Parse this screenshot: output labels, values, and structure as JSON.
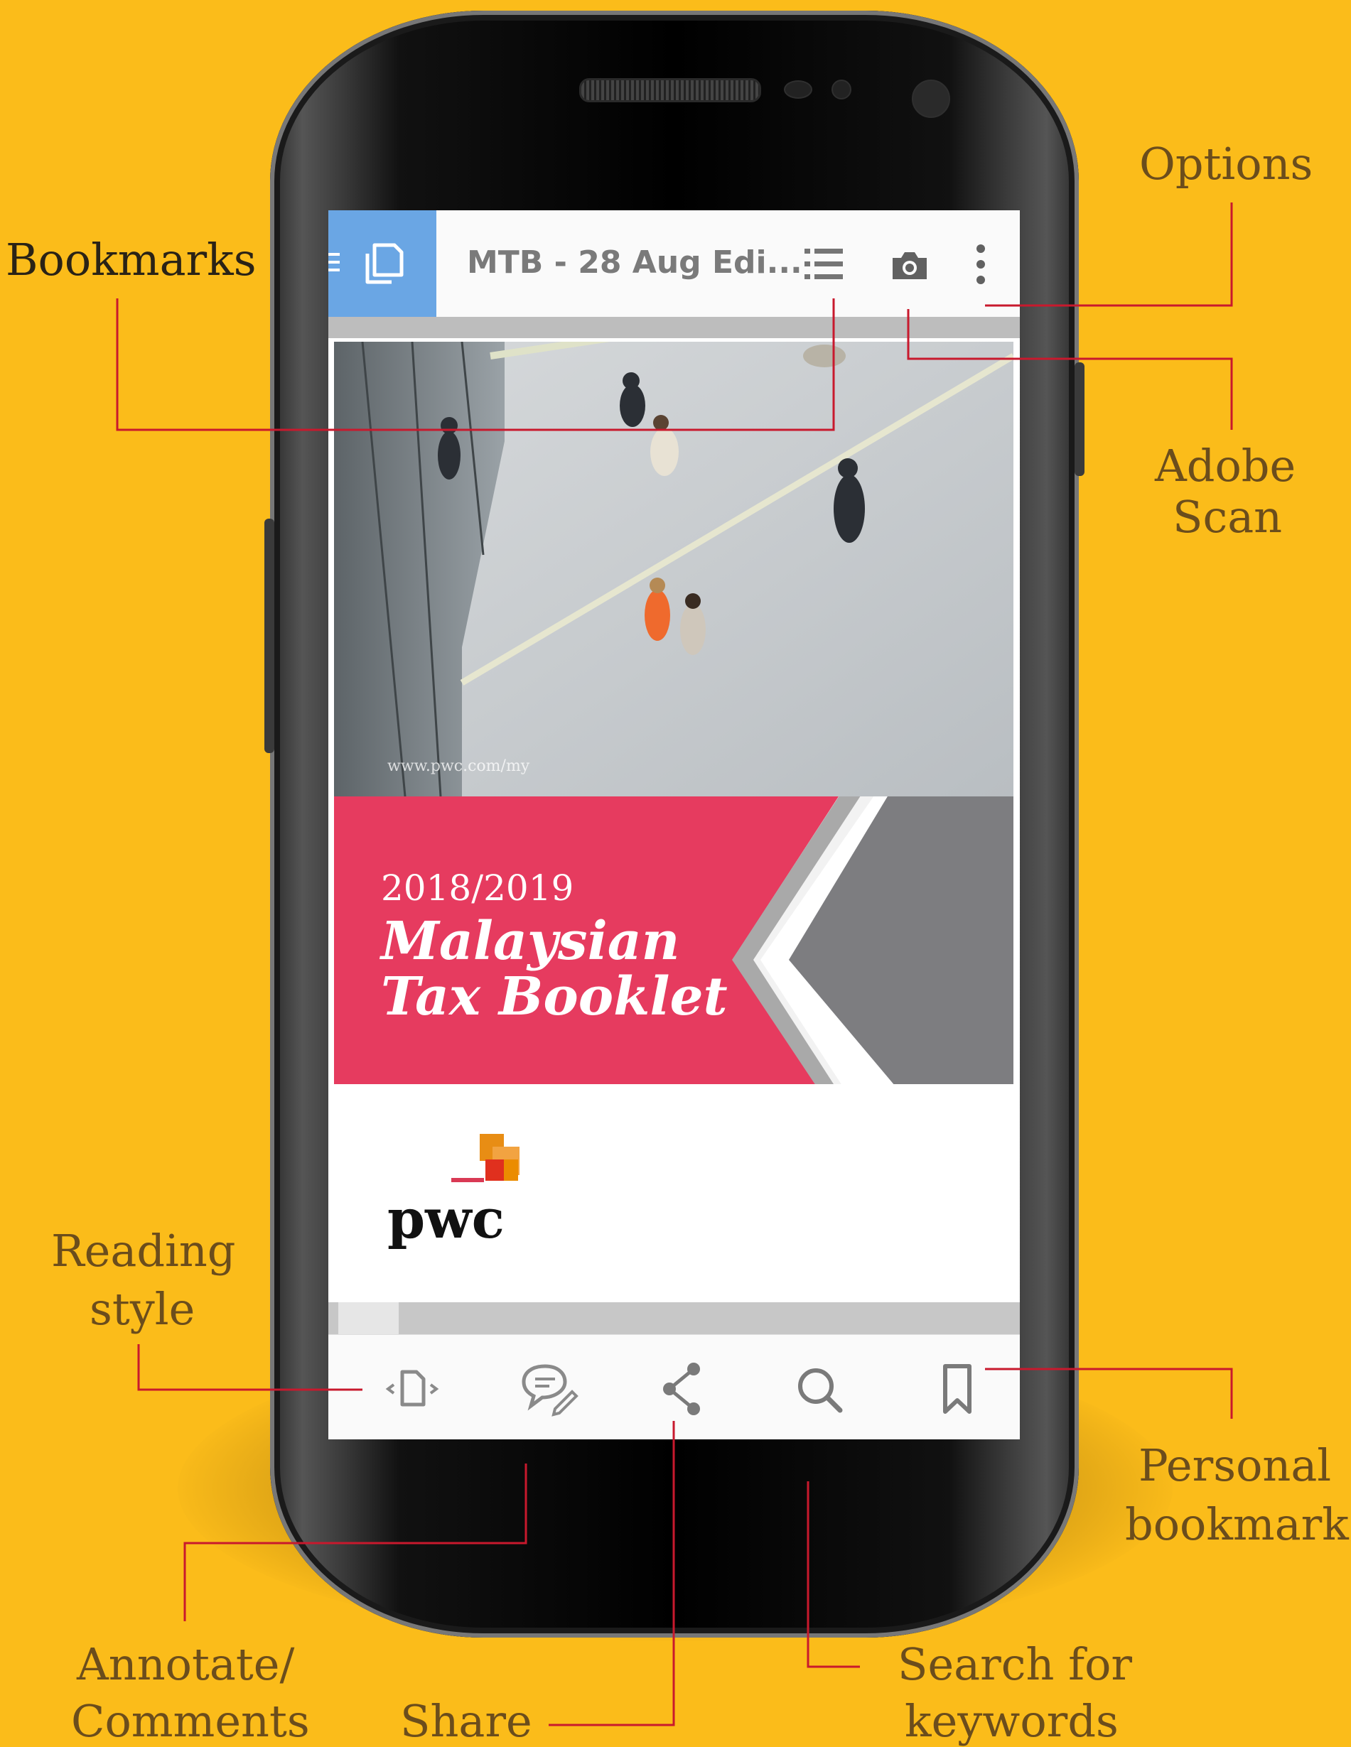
{
  "app": {
    "document_title": "MTB - 28 Aug Edi..."
  },
  "document": {
    "year": "2018/2019",
    "title_line1": "Malaysian",
    "title_line2": "Tax Booklet",
    "logo_text": "pwc",
    "watermark": "www.pwc.com/my"
  },
  "callouts": {
    "bookmarks": "Bookmarks",
    "options": "Options",
    "adobe_scan_line1": "Adobe",
    "adobe_scan_line2": "Scan",
    "reading_style_line1": "Reading",
    "reading_style_line2": "style",
    "personal_bookmark_line1": "Personal",
    "personal_bookmark_line2": "bookmark",
    "annotate_line1": "Annotate/",
    "annotate_line2": "Comments",
    "share": "Share",
    "search_line1": "Search for",
    "search_line2": "keywords"
  },
  "icons": {
    "top_bar": [
      "menu-icon",
      "document-icon",
      "bookmarks-list-icon",
      "camera-icon",
      "more-vert-icon"
    ],
    "bottom_bar": [
      "reading-style-icon",
      "comment-icon",
      "share-icon",
      "search-icon",
      "bookmark-icon"
    ]
  },
  "colors": {
    "background": "#fbbc1a",
    "callout_text": "#6b4d1c",
    "leader_line": "#c8192d",
    "banner_pink": "#e63b5f",
    "nav_blue": "#6aa6e4"
  }
}
